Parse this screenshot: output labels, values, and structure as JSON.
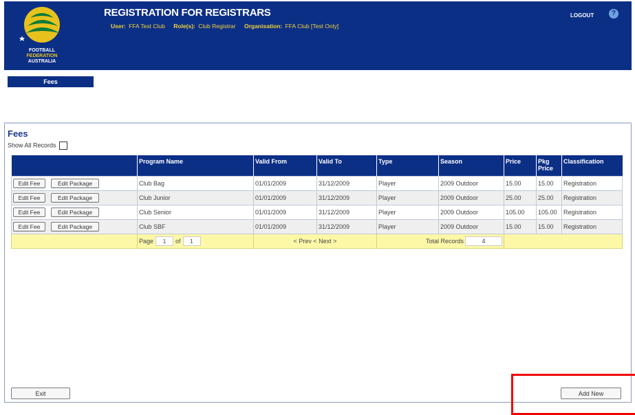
{
  "header": {
    "title": "REGISTRATION FOR REGISTRARS",
    "user_label": "User:",
    "user_value": "FFA Test Club",
    "roles_label": "Role(s):",
    "roles_value": "Club Registrar",
    "org_label": "Organisation:",
    "org_value": "FFA Club [Test Only]",
    "logout": "LOGOUT",
    "help": "?",
    "logo_line1": "FOOTBALL",
    "logo_line2": "FEDERATION",
    "logo_line3": "AUSTRALIA"
  },
  "nav": {
    "tab": "Fees"
  },
  "section": {
    "title": "Fees",
    "show_all": "Show All Records"
  },
  "table": {
    "headers": [
      "",
      "Program Name",
      "Valid From",
      "Valid To",
      "Type",
      "Season",
      "Price",
      "Pkg Price",
      "Classification"
    ],
    "edit_fee": "Edit Fee",
    "edit_package": "Edit Package",
    "rows": [
      {
        "program": "Club Bag",
        "from": "01/01/2009",
        "to": "31/12/2009",
        "type": "Player",
        "season": "2009 Outdoor",
        "price": "15.00",
        "pkg": "15.00",
        "class": "Registration"
      },
      {
        "program": "Club Junior",
        "from": "01/01/2009",
        "to": "31/12/2009",
        "type": "Player",
        "season": "2009 Outdoor",
        "price": "25.00",
        "pkg": "25.00",
        "class": "Registration"
      },
      {
        "program": "Club Senior",
        "from": "01/01/2009",
        "to": "31/12/2009",
        "type": "Player",
        "season": "2009 Outdoor",
        "price": "105.00",
        "pkg": "105.00",
        "class": "Registration"
      },
      {
        "program": "Club SBF",
        "from": "01/01/2009",
        "to": "31/12/2009",
        "type": "Player",
        "season": "2009 Outdoor",
        "price": "15.00",
        "pkg": "15.00",
        "class": "Registration"
      }
    ],
    "pager": {
      "page_label": "Page",
      "page": "1",
      "of_label": "of",
      "pages": "1",
      "prev": "< Prev",
      "next": "< Next >",
      "total_label": "Total Records",
      "total": "4"
    }
  },
  "footer": {
    "exit": "Exit",
    "add_new": "Add New"
  },
  "colors": {
    "brand": "#0c2f86",
    "accent": "#f0d33a",
    "highlight": "#e00000"
  }
}
